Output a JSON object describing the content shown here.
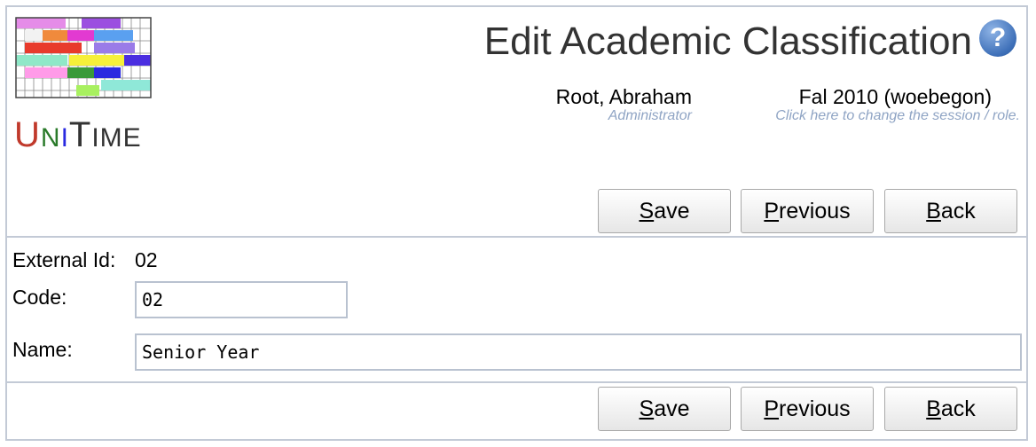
{
  "header": {
    "title": "Edit Academic Classification",
    "logo_text": "UniTime",
    "help_icon": "help-icon"
  },
  "user": {
    "name": "Root, Abraham",
    "role": "Administrator"
  },
  "session": {
    "name": "Fal 2010 (woebegon)",
    "hint": "Click here to change the session / role."
  },
  "toolbar": {
    "save_label": "Save",
    "previous_label": "Previous",
    "back_label": "Back"
  },
  "form": {
    "external_id_label": "External Id:",
    "external_id_value": "02",
    "code_label": "Code:",
    "code_value": "02",
    "name_label": "Name:",
    "name_value": "Senior Year"
  },
  "colors": {
    "border": "#c3cad6",
    "hint": "#8fa4c4"
  }
}
